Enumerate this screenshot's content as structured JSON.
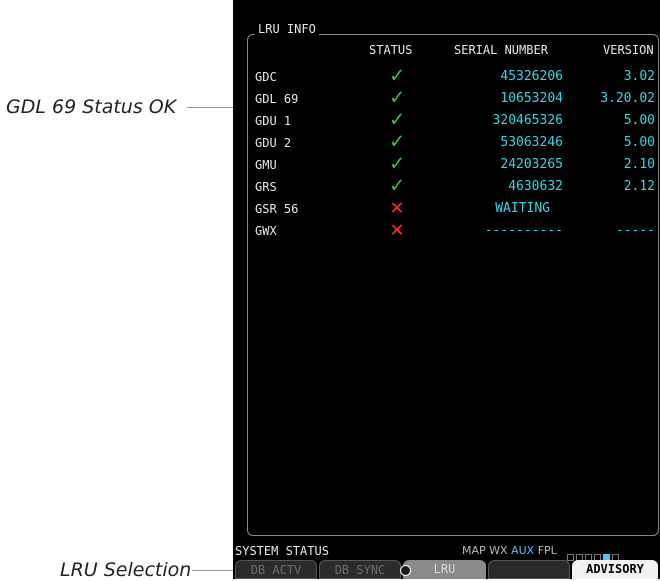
{
  "callouts": {
    "status_ok": "GDL 69 Status OK",
    "lru_selection": "LRU Selection"
  },
  "panel": {
    "title": "LRU INFO",
    "headers": {
      "status": "STATUS",
      "serial": "SERIAL NUMBER",
      "version": "VERSION"
    }
  },
  "lru_rows": [
    {
      "name": "GDC",
      "status": "ok",
      "serial": "45326206",
      "version": "3.02"
    },
    {
      "name": "GDL 69",
      "status": "ok",
      "serial": "10653204",
      "version": "3.20.02"
    },
    {
      "name": "GDU 1",
      "status": "ok",
      "serial": "320465326",
      "version": "5.00"
    },
    {
      "name": "GDU 2",
      "status": "ok",
      "serial": "53063246",
      "version": "5.00"
    },
    {
      "name": "GMU",
      "status": "ok",
      "serial": "24203265",
      "version": "2.10"
    },
    {
      "name": "GRS",
      "status": "ok",
      "serial": "4630632",
      "version": "2.12"
    },
    {
      "name": "GSR 56",
      "status": "fail",
      "serial": "WAITING",
      "version": ""
    },
    {
      "name": "GWX",
      "status": "fail",
      "serial": "----------",
      "version": "-----"
    }
  ],
  "status_glyphs": {
    "ok": "✓",
    "fail": "✕"
  },
  "status_bar": {
    "label": "SYSTEM STATUS",
    "page_groups": [
      "MAP",
      "WX",
      "AUX",
      "FPL"
    ],
    "active_group": "AUX",
    "page_count": 6,
    "active_page": 5
  },
  "softkeys": [
    {
      "label": "DB ACTV",
      "state": "dim"
    },
    {
      "label": "DB SYNC",
      "state": "dim"
    },
    {
      "label": "LRU",
      "state": "selected"
    },
    {
      "label": "",
      "state": "blank"
    },
    {
      "label": "ADVISORY",
      "state": "on"
    }
  ],
  "colors": {
    "status_ok": "#33cc33",
    "status_fail": "#ff2a2a",
    "data_cyan": "#33d6e6",
    "active_page": "#4fc3ff"
  }
}
